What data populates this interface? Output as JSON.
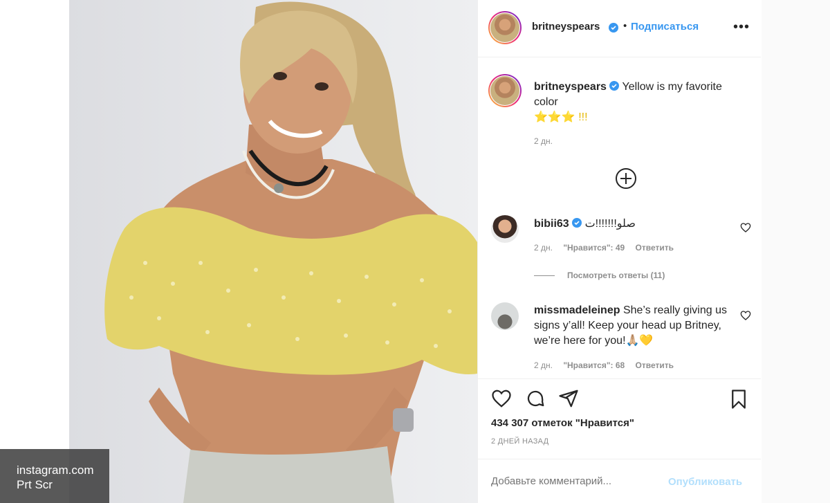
{
  "post": {
    "username": "britneyspears",
    "dot": "•",
    "follow_label": "Подписаться",
    "more_label": "•••",
    "caption_text": "Yellow is my favorite color",
    "caption_emoji": "⭐⭐⭐ !!!",
    "caption_time": "2 дн."
  },
  "comments": [
    {
      "username": "bibii63",
      "text": "صلو!!!!!!!ت",
      "time": "2 дн.",
      "likes_label": "\"Нравится\": 49",
      "reply_label": "Ответить",
      "view_replies": "Посмотреть ответы (11)"
    },
    {
      "username": "missmadeleinep",
      "text": "She’s really giving us signs y’all! Keep your head up Britney, we’re here for you!🙏🏼💛",
      "time": "2 дн.",
      "likes_label": "\"Нравится\": 68",
      "reply_label": "Ответить"
    }
  ],
  "footer": {
    "likes": "434 307 отметок \"Нравится\"",
    "date": "2 ДНЕЙ НАЗАД",
    "comment_placeholder": "Добавьте комментарий...",
    "publish_label": "Опубликовать"
  },
  "watermark": {
    "line1": "instagram.com",
    "line2": "Prt Scr"
  },
  "colors": {
    "link": "#3897f0",
    "muted": "#8e8e8e",
    "publish_disabled": "#b2dffc",
    "top_yellow": "#e8d96a"
  }
}
